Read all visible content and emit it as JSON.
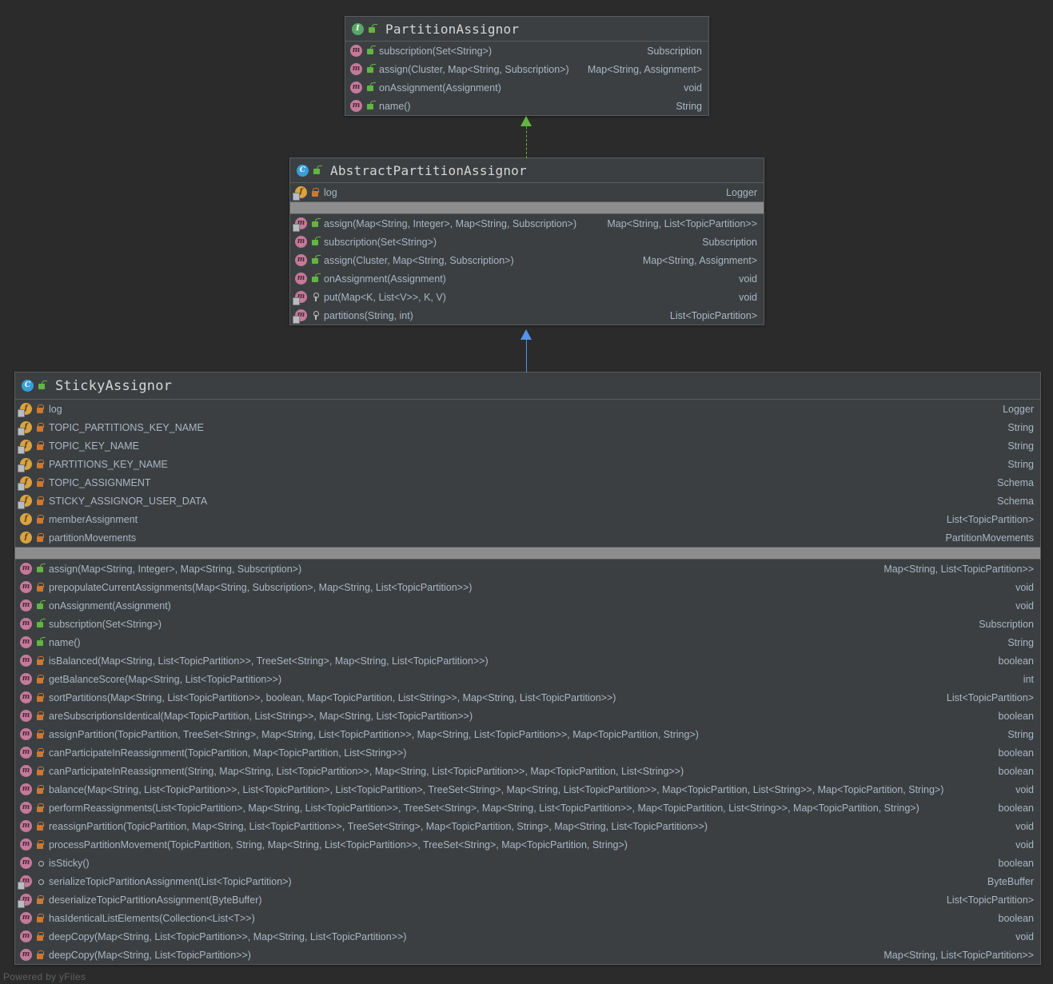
{
  "watermark": "Powered by yFiles",
  "classes": {
    "partition_assignor": {
      "name": "PartitionAssignor",
      "kind_icon": "interface-icon",
      "kind_letter": "I",
      "visibility": "public",
      "members": [
        {
          "icon": "method-icon",
          "visibility": "public",
          "static": false,
          "signature": "subscription(Set<String>)",
          "type": "Subscription"
        },
        {
          "icon": "method-icon",
          "visibility": "public",
          "static": false,
          "signature": "assign(Cluster, Map<String, Subscription>)",
          "type": "Map<String, Assignment>"
        },
        {
          "icon": "method-icon",
          "visibility": "public",
          "static": false,
          "signature": "onAssignment(Assignment)",
          "type": "void"
        },
        {
          "icon": "method-icon",
          "visibility": "public",
          "static": false,
          "signature": "name()",
          "type": "String"
        }
      ]
    },
    "abstract_partition_assignor": {
      "name": "AbstractPartitionAssignor",
      "kind_icon": "class-icon",
      "kind_letter": "C",
      "visibility": "public",
      "fields": [
        {
          "icon": "field-icon",
          "visibility": "private",
          "static": true,
          "signature": "log",
          "type": "Logger"
        }
      ],
      "methods": [
        {
          "icon": "method-icon",
          "visibility": "public",
          "static": true,
          "signature": "assign(Map<String, Integer>, Map<String, Subscription>)",
          "type": "Map<String, List<TopicPartition>>"
        },
        {
          "icon": "method-icon",
          "visibility": "public",
          "static": false,
          "signature": "subscription(Set<String>)",
          "type": "Subscription"
        },
        {
          "icon": "method-icon",
          "visibility": "public",
          "static": false,
          "signature": "assign(Cluster, Map<String, Subscription>)",
          "type": "Map<String, Assignment>"
        },
        {
          "icon": "method-icon",
          "visibility": "public",
          "static": false,
          "signature": "onAssignment(Assignment)",
          "type": "void"
        },
        {
          "icon": "method-icon",
          "visibility": "protected",
          "static": true,
          "signature": "put(Map<K, List<V>>, K, V)",
          "type": "void"
        },
        {
          "icon": "method-icon",
          "visibility": "protected",
          "static": true,
          "signature": "partitions(String, int)",
          "type": "List<TopicPartition>"
        }
      ]
    },
    "sticky_assignor": {
      "name": "StickyAssignor",
      "kind_icon": "class-icon",
      "kind_letter": "C",
      "visibility": "public",
      "fields": [
        {
          "icon": "field-icon",
          "visibility": "private",
          "static": true,
          "signature": "log",
          "type": "Logger"
        },
        {
          "icon": "field-icon",
          "visibility": "private",
          "static": true,
          "signature": "TOPIC_PARTITIONS_KEY_NAME",
          "type": "String"
        },
        {
          "icon": "field-icon",
          "visibility": "private",
          "static": true,
          "signature": "TOPIC_KEY_NAME",
          "type": "String"
        },
        {
          "icon": "field-icon",
          "visibility": "private",
          "static": true,
          "signature": "PARTITIONS_KEY_NAME",
          "type": "String"
        },
        {
          "icon": "field-icon",
          "visibility": "private",
          "static": true,
          "signature": "TOPIC_ASSIGNMENT",
          "type": "Schema"
        },
        {
          "icon": "field-icon",
          "visibility": "private",
          "static": true,
          "signature": "STICKY_ASSIGNOR_USER_DATA",
          "type": "Schema"
        },
        {
          "icon": "field-icon",
          "visibility": "private",
          "static": false,
          "signature": "memberAssignment",
          "type": "List<TopicPartition>"
        },
        {
          "icon": "field-icon",
          "visibility": "private",
          "static": false,
          "signature": "partitionMovements",
          "type": "PartitionMovements"
        }
      ],
      "methods": [
        {
          "icon": "method-icon",
          "visibility": "public",
          "static": false,
          "signature": "assign(Map<String, Integer>, Map<String, Subscription>)",
          "type": "Map<String, List<TopicPartition>>"
        },
        {
          "icon": "method-icon",
          "visibility": "private",
          "static": false,
          "signature": "prepopulateCurrentAssignments(Map<String, Subscription>, Map<String, List<TopicPartition>>)",
          "type": "void"
        },
        {
          "icon": "method-icon",
          "visibility": "public",
          "static": false,
          "signature": "onAssignment(Assignment)",
          "type": "void"
        },
        {
          "icon": "method-icon",
          "visibility": "public",
          "static": false,
          "signature": "subscription(Set<String>)",
          "type": "Subscription"
        },
        {
          "icon": "method-icon",
          "visibility": "public",
          "static": false,
          "signature": "name()",
          "type": "String"
        },
        {
          "icon": "method-icon",
          "visibility": "private",
          "static": false,
          "signature": "isBalanced(Map<String, List<TopicPartition>>, TreeSet<String>, Map<String, List<TopicPartition>>)",
          "type": "boolean"
        },
        {
          "icon": "method-icon",
          "visibility": "private",
          "static": false,
          "signature": "getBalanceScore(Map<String, List<TopicPartition>>)",
          "type": "int"
        },
        {
          "icon": "method-icon",
          "visibility": "private",
          "static": false,
          "signature": "sortPartitions(Map<String, List<TopicPartition>>, boolean, Map<TopicPartition, List<String>>, Map<String, List<TopicPartition>>)",
          "type": "List<TopicPartition>"
        },
        {
          "icon": "method-icon",
          "visibility": "private",
          "static": false,
          "signature": "areSubscriptionsIdentical(Map<TopicPartition, List<String>>, Map<String, List<TopicPartition>>)",
          "type": "boolean"
        },
        {
          "icon": "method-icon",
          "visibility": "private",
          "static": false,
          "signature": "assignPartition(TopicPartition, TreeSet<String>, Map<String, List<TopicPartition>>, Map<String, List<TopicPartition>>, Map<TopicPartition, String>)",
          "type": "String"
        },
        {
          "icon": "method-icon",
          "visibility": "private",
          "static": false,
          "signature": "canParticipateInReassignment(TopicPartition, Map<TopicPartition, List<String>>)",
          "type": "boolean"
        },
        {
          "icon": "method-icon",
          "visibility": "private",
          "static": false,
          "signature": "canParticipateInReassignment(String, Map<String, List<TopicPartition>>, Map<String, List<TopicPartition>>, Map<TopicPartition, List<String>>)",
          "type": "boolean"
        },
        {
          "icon": "method-icon",
          "visibility": "private",
          "static": false,
          "signature": "balance(Map<String, List<TopicPartition>>, List<TopicPartition>, List<TopicPartition>, TreeSet<String>, Map<String, List<TopicPartition>>, Map<TopicPartition, List<String>>, Map<TopicPartition, String>)",
          "type": "void"
        },
        {
          "icon": "method-icon",
          "visibility": "private",
          "static": false,
          "signature": "performReassignments(List<TopicPartition>, Map<String, List<TopicPartition>>, TreeSet<String>, Map<String, List<TopicPartition>>, Map<TopicPartition, List<String>>, Map<TopicPartition, String>)",
          "type": "boolean"
        },
        {
          "icon": "method-icon",
          "visibility": "private",
          "static": false,
          "signature": "reassignPartition(TopicPartition, Map<String, List<TopicPartition>>, TreeSet<String>, Map<TopicPartition, String>, Map<String, List<TopicPartition>>)",
          "type": "void"
        },
        {
          "icon": "method-icon",
          "visibility": "private",
          "static": false,
          "signature": "processPartitionMovement(TopicPartition, String, Map<String, List<TopicPartition>>, TreeSet<String>, Map<TopicPartition, String>)",
          "type": "void"
        },
        {
          "icon": "method-icon",
          "visibility": "package",
          "static": false,
          "signature": "isSticky()",
          "type": "boolean"
        },
        {
          "icon": "method-icon",
          "visibility": "package",
          "static": true,
          "signature": "serializeTopicPartitionAssignment(List<TopicPartition>)",
          "type": "ByteBuffer"
        },
        {
          "icon": "method-icon",
          "visibility": "private",
          "static": true,
          "signature": "deserializeTopicPartitionAssignment(ByteBuffer)",
          "type": "List<TopicPartition>"
        },
        {
          "icon": "method-icon",
          "visibility": "private",
          "static": false,
          "signature": "hasIdenticalListElements(Collection<List<T>>)",
          "type": "boolean"
        },
        {
          "icon": "method-icon",
          "visibility": "private",
          "static": false,
          "signature": "deepCopy(Map<String, List<TopicPartition>>, Map<String, List<TopicPartition>>)",
          "type": "void"
        },
        {
          "icon": "method-icon",
          "visibility": "private",
          "static": false,
          "signature": "deepCopy(Map<String, List<TopicPartition>>)",
          "type": "Map<String, List<TopicPartition>>"
        }
      ]
    }
  },
  "connectors": [
    {
      "name": "realization-partitionassignor",
      "style": "dashed",
      "color": "#62b543"
    },
    {
      "name": "generalization-abstractpartitionassignor",
      "style": "solid",
      "color": "#5394ec"
    }
  ]
}
